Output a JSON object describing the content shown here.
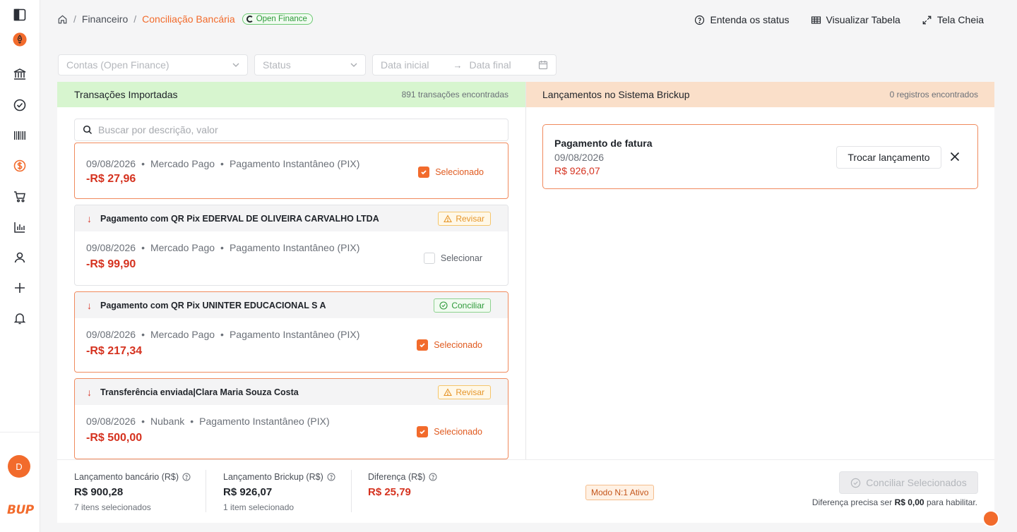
{
  "sidebar": {
    "items": [
      "panel-toggle",
      "rocket",
      "bank",
      "check-circle",
      "barcode",
      "dollar-circle",
      "cart",
      "bar-chart",
      "user",
      "plus",
      "bell"
    ],
    "avatar_initial": "D",
    "brand": "BUP"
  },
  "breadcrumb": {
    "root": "Financeiro",
    "current": "Conciliação Bancária",
    "badge": "Open Finance"
  },
  "header_actions": {
    "status": "Entenda os status",
    "table": "Visualizar Tabela",
    "fullscreen": "Tela Cheia"
  },
  "filters": {
    "accounts_placeholder": "Contas (Open Finance)",
    "status_placeholder": "Status",
    "date_start": "Data inicial",
    "date_end": "Data final"
  },
  "left_panel": {
    "title": "Transações Importadas",
    "count": "891 transações encontradas",
    "search_placeholder": "Buscar por descrição, valor",
    "cards": [
      {
        "title": "",
        "tag": "",
        "date": "09/08/2026",
        "bank": "Mercado Pago",
        "method": "Pagamento Instantâneo (PIX)",
        "amount": "-R$ 27,96",
        "check": "Selecionado"
      },
      {
        "title": "Pagamento com QR Pix EDERVAL DE OLIVEIRA CARVALHO LTDA",
        "tag": "Revisar",
        "date": "09/08/2026",
        "bank": "Mercado Pago",
        "method": "Pagamento Instantâneo (PIX)",
        "amount": "-R$ 99,90",
        "check": "Selecionar"
      },
      {
        "title": "Pagamento com QR Pix UNINTER EDUCACIONAL S A",
        "tag": "Conciliar",
        "date": "09/08/2026",
        "bank": "Mercado Pago",
        "method": "Pagamento Instantâneo (PIX)",
        "amount": "-R$ 217,34",
        "check": "Selecionado"
      },
      {
        "title": "Transferência enviada|Clara Maria Souza Costa",
        "tag": "Revisar",
        "date": "09/08/2026",
        "bank": "Nubank",
        "method": "Pagamento Instantâneo (PIX)",
        "amount": "-R$ 500,00",
        "check": "Selecionado"
      }
    ]
  },
  "right_panel": {
    "title": "Lançamentos no Sistema Brickup",
    "count": "0 registros encontrados",
    "entry": {
      "title": "Pagamento de fatura",
      "date": "09/08/2026",
      "amount": "R$ 926,07",
      "swap_button": "Trocar lançamento"
    }
  },
  "footer": {
    "bank_label": "Lançamento bancário (R$)",
    "bank_value": "R$ 900,28",
    "bank_sub": "7 itens selecionados",
    "brickup_label": "Lançamento Brickup (R$)",
    "brickup_value": "R$ 926,07",
    "brickup_sub": "1 item selecionado",
    "diff_label": "Diferença (R$)",
    "diff_value": "R$ 25,79",
    "mode_badge": "Modo N:1 Ativo",
    "conciliar_button": "Conciliar Selecionados",
    "hint_prefix": "Diferença precisa ser",
    "hint_value": "R$ 0,00",
    "hint_suffix": "para habilitar."
  },
  "colors": {
    "accent": "#f26b2c",
    "negative": "#d5321f",
    "left_header_bg": "#d7f5cf",
    "right_header_bg": "#fadfc9"
  }
}
